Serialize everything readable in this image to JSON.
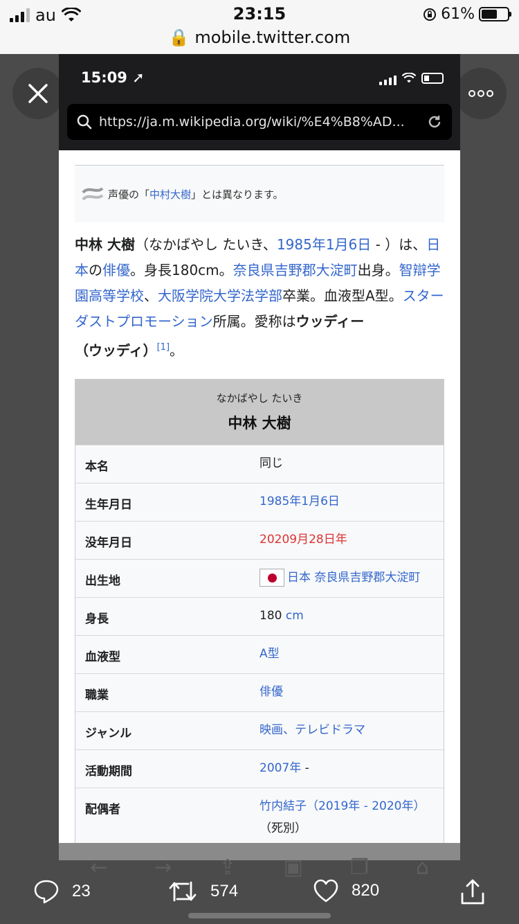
{
  "os_status": {
    "carrier": "au",
    "time": "23:15",
    "battery": "61%",
    "url": "mobile.twitter.com"
  },
  "viewer": {
    "close_icon": "close-icon",
    "more_label": "ooo"
  },
  "inner_status": {
    "time": "15:09"
  },
  "browser": {
    "url": "https://ja.m.wikipedia.org/wiki/%E4%B8%AD..."
  },
  "hatnote": {
    "prefix": "声優の「",
    "link": "中村大樹",
    "suffix": "」とは異なります。"
  },
  "lede": {
    "name": "中林 大樹",
    "t1": "（なかばやし たいき、",
    "birth_link": "1985年1月6日",
    "t2": " - ）は、",
    "japan_link": "日本",
    "t3": "の",
    "actor_link": "俳優",
    "t4": "。身長180cm。",
    "place_link": "奈良県吉野郡大淀町",
    "t5": "出身。",
    "school_link": "智辯学園高等学校",
    "t6": "、",
    "univ_link": "大阪学院大学法学部",
    "t7": "卒業。血液型A型。",
    "agency_link": "スターダストプロモーション",
    "t8": "所属。愛称は",
    "nickname": "ウッディー",
    "t9": "（ウッディ）",
    "ref": "[1]",
    "t10": "。"
  },
  "infobox": {
    "kana": "なかばやし たいき",
    "name": "中林 大樹",
    "rows": [
      {
        "key": "本名",
        "value": "同じ"
      },
      {
        "key": "生年月日",
        "value": "1985年1月6日"
      },
      {
        "key": "没年月日",
        "value": "20209月28日年"
      },
      {
        "key": "出生地",
        "value": "日本 奈良県吉野郡大淀町"
      },
      {
        "key": "身長",
        "value_num": "180",
        "value_unit": "cm"
      },
      {
        "key": "血液型",
        "value": "A型"
      },
      {
        "key": "職業",
        "value": "俳優"
      },
      {
        "key": "ジャンル",
        "value": "映画、テレビドラマ"
      },
      {
        "key": "活動期間",
        "value": "2007年",
        "value_suffix": " -"
      },
      {
        "key": "配偶者",
        "value_link": "竹内結子（2019年 - 2020年）",
        "value_suffix": "（死別）"
      }
    ]
  },
  "actions": {
    "replies": "23",
    "retweets": "574",
    "likes": "820"
  }
}
